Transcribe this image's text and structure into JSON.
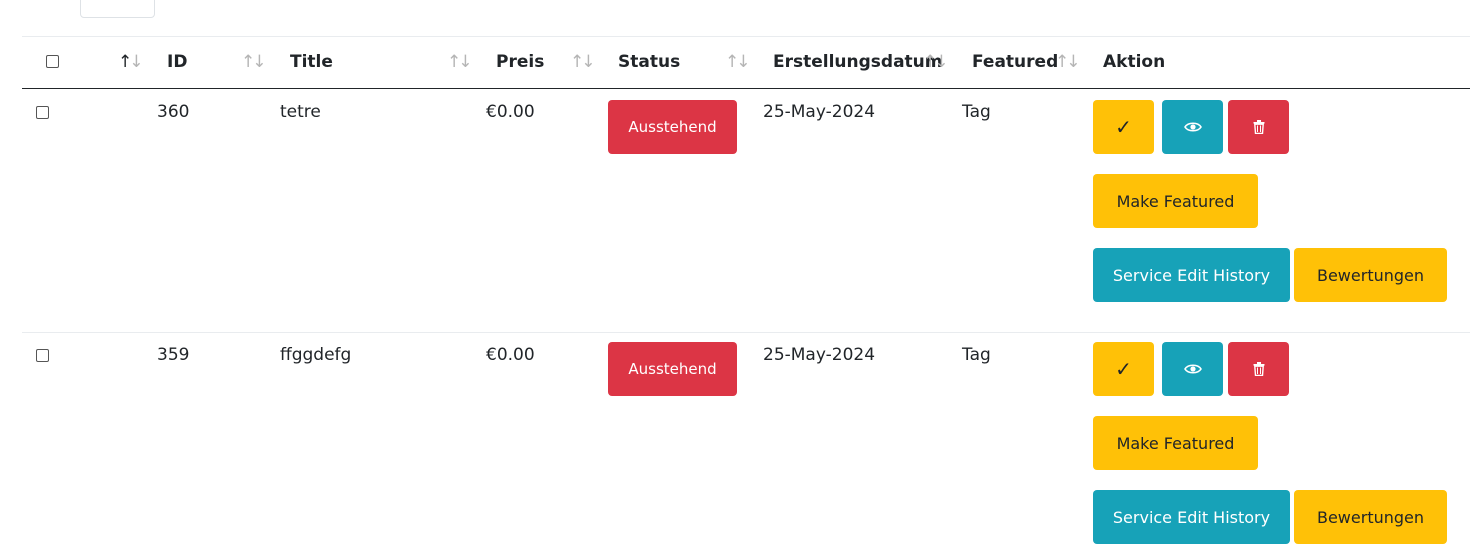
{
  "table": {
    "headers": {
      "id": "ID",
      "title": "Title",
      "price": "Preis",
      "status": "Status",
      "created": "Erstellungsdatum",
      "featured": "Featured",
      "action": "Aktion"
    },
    "sort_glyph": "↑↓",
    "rows": [
      {
        "id": "360",
        "title": "tetre",
        "price": "€0.00",
        "status": "Ausstehend",
        "created": "25-May-2024",
        "featured": "Tag",
        "actions": {
          "approve": "✓",
          "make_featured": "Make Featured",
          "edit_history": "Service Edit History",
          "reviews": "Bewertungen"
        }
      },
      {
        "id": "359",
        "title": "ffggdefg",
        "price": "€0.00",
        "status": "Ausstehend",
        "created": "25-May-2024",
        "featured": "Tag",
        "actions": {
          "approve": "✓",
          "make_featured": "Make Featured",
          "edit_history": "Service Edit History",
          "reviews": "Bewertungen"
        }
      }
    ]
  },
  "colors": {
    "warning": "#ffc107",
    "info": "#17a2b8",
    "danger": "#dc3545"
  }
}
